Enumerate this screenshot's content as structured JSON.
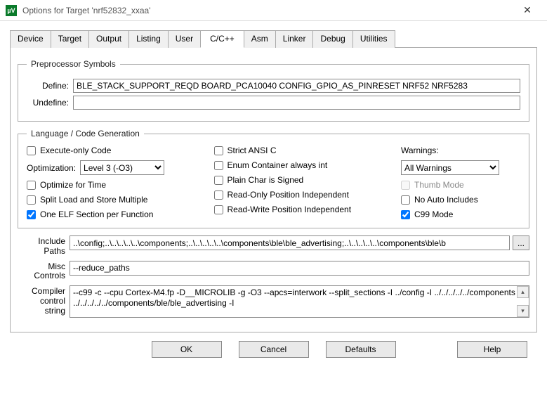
{
  "window": {
    "title": "Options for Target 'nrf52832_xxaa'",
    "icon_label": "µV"
  },
  "tabs": [
    "Device",
    "Target",
    "Output",
    "Listing",
    "User",
    "C/C++",
    "Asm",
    "Linker",
    "Debug",
    "Utilities"
  ],
  "active_tab": "C/C++",
  "preproc": {
    "legend": "Preprocessor Symbols",
    "define_label": "Define:",
    "define_value": "BLE_STACK_SUPPORT_REQD BOARD_PCA10040 CONFIG_GPIO_AS_PINRESET NRF52 NRF5283",
    "undefine_label": "Undefine:",
    "undefine_value": ""
  },
  "lang": {
    "legend": "Language / Code Generation",
    "col1": {
      "execute_only": {
        "label": "Execute-only Code",
        "checked": false
      },
      "optimization_label": "Optimization:",
      "optimization_value": "Level 3 (-O3)",
      "optimize_time": {
        "label": "Optimize for Time",
        "checked": false
      },
      "split_load": {
        "label": "Split Load and Store Multiple",
        "checked": false
      },
      "one_elf": {
        "label": "One ELF Section per Function",
        "checked": true
      }
    },
    "col2": {
      "strict_ansi": {
        "label": "Strict ANSI C",
        "checked": false
      },
      "enum_int": {
        "label": "Enum Container always int",
        "checked": false
      },
      "plain_char": {
        "label": "Plain Char is Signed",
        "checked": false
      },
      "ro_pi": {
        "label": "Read-Only Position Independent",
        "checked": false
      },
      "rw_pi": {
        "label": "Read-Write Position Independent",
        "checked": false
      }
    },
    "col3": {
      "warnings_label": "Warnings:",
      "warnings_value": "All Warnings",
      "thumb": {
        "label": "Thumb Mode",
        "checked": false,
        "disabled": true
      },
      "no_auto_inc": {
        "label": "No Auto Includes",
        "checked": false
      },
      "c99": {
        "label": "C99 Mode",
        "checked": true
      }
    }
  },
  "paths": {
    "include_label": "Include Paths",
    "include_value": "..\\config;..\\..\\..\\..\\..\\components;..\\..\\..\\..\\..\\components\\ble\\ble_advertising;..\\..\\..\\..\\..\\components\\ble\\b",
    "browse": "...",
    "misc_label": "Misc Controls",
    "misc_value": "--reduce_paths",
    "compiler_label": "Compiler control string",
    "compiler_value": "--c99 -c --cpu Cortex-M4.fp -D__MICROLIB -g -O3 --apcs=interwork --split_sections -I ../config -I ../../../../../components -I ../../../../../components/ble/ble_advertising -I"
  },
  "buttons": {
    "ok": "OK",
    "cancel": "Cancel",
    "defaults": "Defaults",
    "help": "Help"
  }
}
